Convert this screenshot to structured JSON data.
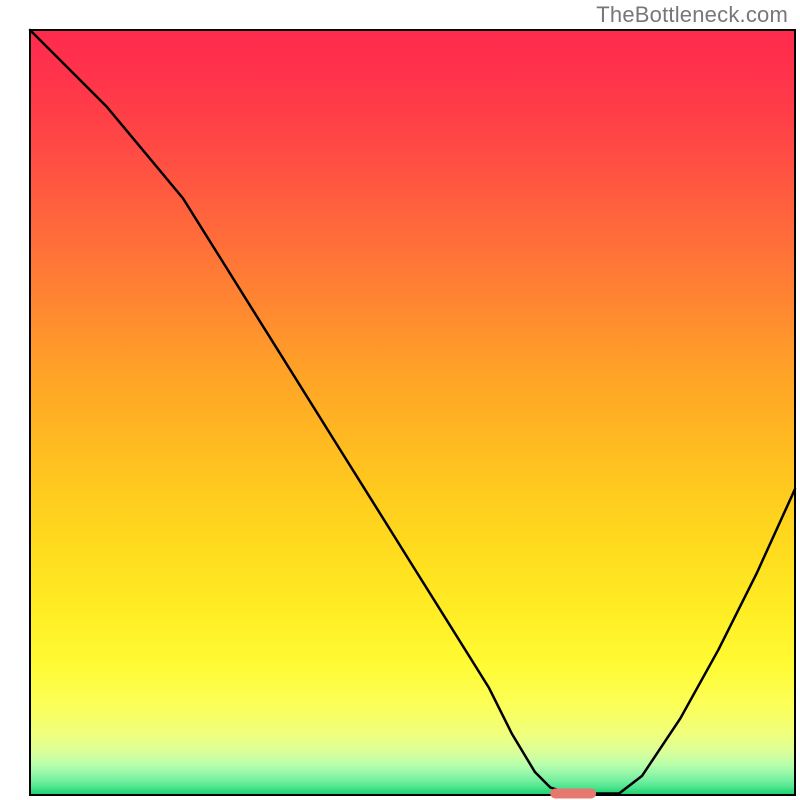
{
  "watermark": "TheBottleneck.com",
  "chart_data": {
    "type": "line",
    "title": "",
    "xlabel": "",
    "ylabel": "",
    "xlim": [
      0,
      100
    ],
    "ylim": [
      0,
      100
    ],
    "grid": false,
    "legend": false,
    "annotations": [],
    "background_gradient_stops": [
      {
        "offset": 0.0,
        "color": "#ff2a4d"
      },
      {
        "offset": 0.06,
        "color": "#ff334b"
      },
      {
        "offset": 0.13,
        "color": "#ff4346"
      },
      {
        "offset": 0.21,
        "color": "#ff5a40"
      },
      {
        "offset": 0.29,
        "color": "#ff7238"
      },
      {
        "offset": 0.37,
        "color": "#ff8a30"
      },
      {
        "offset": 0.44,
        "color": "#ffa028"
      },
      {
        "offset": 0.52,
        "color": "#ffb522"
      },
      {
        "offset": 0.6,
        "color": "#ffca1e"
      },
      {
        "offset": 0.68,
        "color": "#ffdc1e"
      },
      {
        "offset": 0.76,
        "color": "#ffed24"
      },
      {
        "offset": 0.83,
        "color": "#fffb34"
      },
      {
        "offset": 0.88,
        "color": "#fcff56"
      },
      {
        "offset": 0.92,
        "color": "#f0ff7c"
      },
      {
        "offset": 0.945,
        "color": "#d8ff9a"
      },
      {
        "offset": 0.96,
        "color": "#b8ffac"
      },
      {
        "offset": 0.972,
        "color": "#94f7a8"
      },
      {
        "offset": 0.982,
        "color": "#70ee9e"
      },
      {
        "offset": 0.99,
        "color": "#4de48e"
      },
      {
        "offset": 0.995,
        "color": "#2fd97c"
      },
      {
        "offset": 1.0,
        "color": "#19cf6b"
      }
    ],
    "series": [
      {
        "name": "bottleneck-curve",
        "x": [
          0,
          5,
          10,
          15,
          20,
          25,
          30,
          35,
          40,
          45,
          50,
          55,
          60,
          63,
          66,
          68,
          71,
          74,
          77,
          80,
          85,
          90,
          95,
          100
        ],
        "y": [
          100,
          95,
          90,
          84,
          78,
          70,
          62,
          54,
          46,
          38,
          30,
          22,
          14,
          8,
          3,
          1,
          0,
          0.2,
          0.2,
          2.5,
          10,
          19,
          29,
          40
        ]
      }
    ],
    "optimal_marker": {
      "x_start": 68,
      "x_end": 74,
      "y": 0.2,
      "color": "#e8786f"
    }
  }
}
